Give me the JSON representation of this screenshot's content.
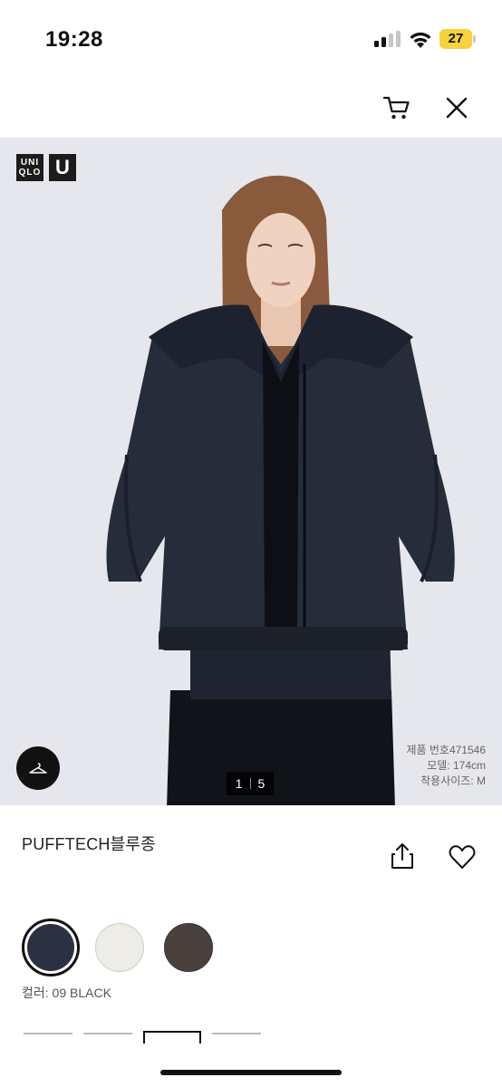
{
  "status": {
    "time": "19:28",
    "battery": "27"
  },
  "header": {
    "cart_icon": "cart-icon",
    "close_icon": "close-icon"
  },
  "hero": {
    "logo_text": "UNIQLO",
    "logo_u": "U",
    "pager": {
      "current": "1",
      "total": "5"
    },
    "product_no": "제품 번호471546",
    "model_height": "모델: 174cm",
    "model_size": "착용사이즈: M"
  },
  "product": {
    "name": "PUFFTECH블루종",
    "color_label": "컬러: 09 BLACK",
    "swatches": [
      {
        "name": "black",
        "color": "#2b3140",
        "selected": true
      },
      {
        "name": "off-white",
        "color": "#eeece6",
        "selected": false
      },
      {
        "name": "brown",
        "color": "#4a403d",
        "selected": false
      }
    ]
  },
  "colors": {
    "accent": "#111111",
    "hero_bg": "#e6e7ec",
    "battery": "#f7d23a"
  }
}
